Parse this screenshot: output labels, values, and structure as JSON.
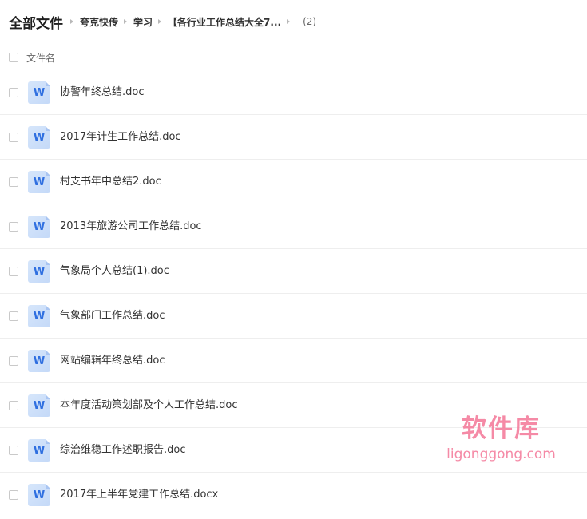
{
  "breadcrumb": {
    "root": "全部文件",
    "items": [
      "夸克快传",
      "学习",
      "【各行业工作总结大全7..."
    ],
    "count": "(2)"
  },
  "list_header": {
    "name_column": "文件名"
  },
  "file_icon_letter": "W",
  "file_icon": "word-document-icon",
  "files": [
    {
      "name": "协警年终总结.doc"
    },
    {
      "name": "2017年计生工作总结.doc"
    },
    {
      "name": "村支书年中总结2.doc"
    },
    {
      "name": "2013年旅游公司工作总结.doc"
    },
    {
      "name": "气象局个人总结(1).doc"
    },
    {
      "name": "气象部门工作总结.doc"
    },
    {
      "name": "网站编辑年终总结.doc"
    },
    {
      "name": "本年度活动策划部及个人工作总结.doc"
    },
    {
      "name": "综治维稳工作述职报告.doc"
    },
    {
      "name": "2017年上半年党建工作总结.docx"
    }
  ],
  "watermark": {
    "title": "软件库",
    "domain": "ligonggong.com"
  },
  "colors": {
    "accent": "#2f6fe0",
    "watermark": "#f47a9a"
  }
}
